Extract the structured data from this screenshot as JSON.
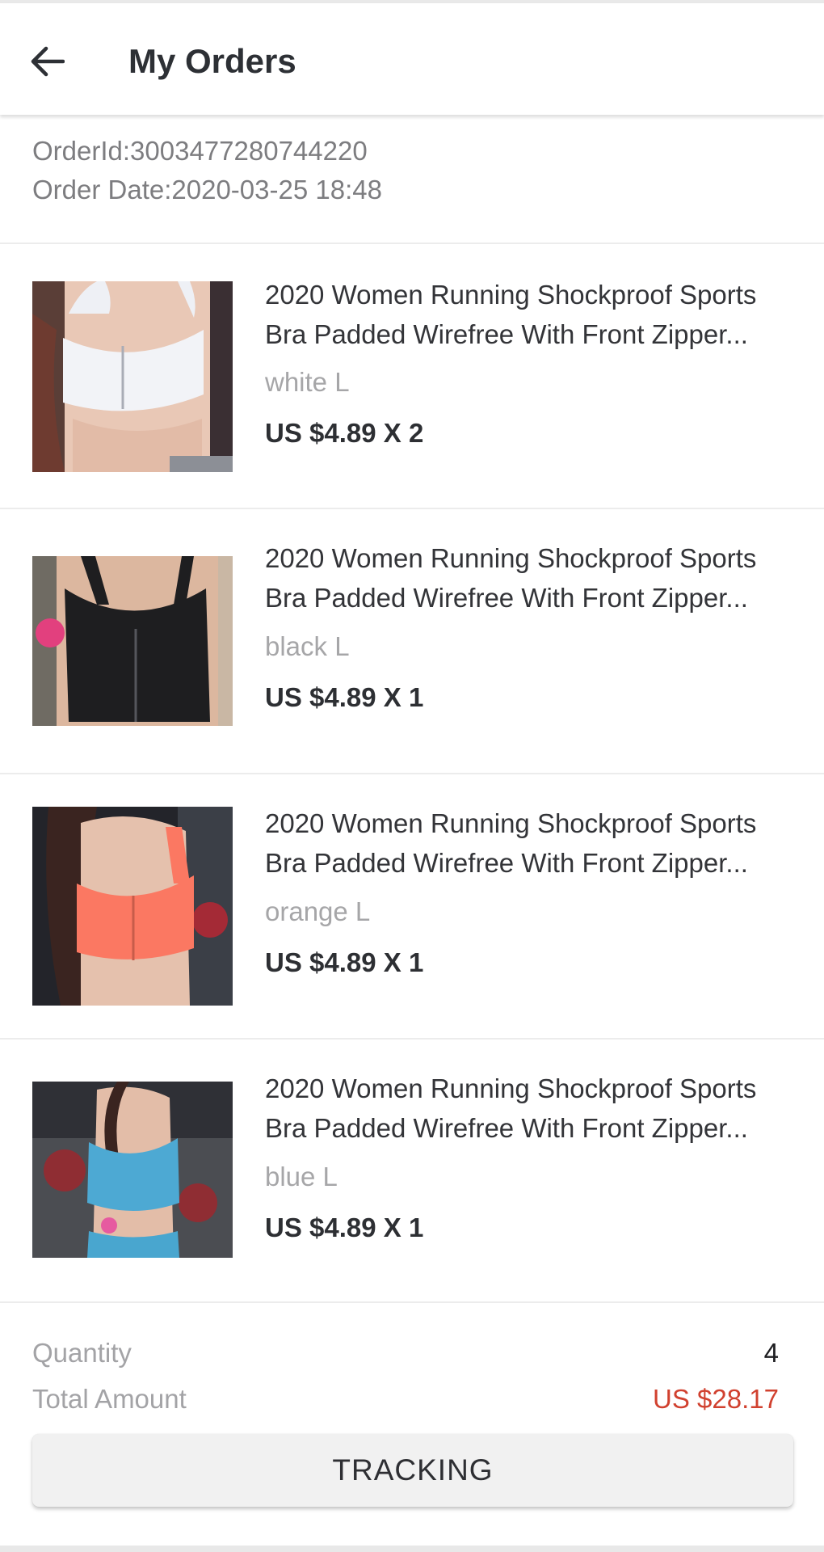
{
  "header": {
    "title": "My Orders",
    "back_icon": "arrow-left-icon"
  },
  "order": {
    "id_line": "OrderId:3003477280744220",
    "date_line": "Order Date:2020-03-25 18:48"
  },
  "items": [
    {
      "title": "2020 Women Running Shockproof Sports Bra Padded Wirefree With Front Zipper...",
      "variant": "white L",
      "price_line": "US $4.89 X 2",
      "color": "#f2f3f7"
    },
    {
      "title": "2020 Women Running Shockproof Sports Bra Padded Wirefree With Front Zipper...",
      "variant": "black L",
      "price_line": "US $4.89 X 1",
      "color": "#1e1e20"
    },
    {
      "title": "2020 Women Running Shockproof Sports Bra Padded Wirefree With Front Zipper...",
      "variant": "orange L",
      "price_line": "US $4.89 X 1",
      "color": "#fb7862"
    },
    {
      "title": "2020 Women Running Shockproof Sports Bra Padded Wirefree With Front Zipper...",
      "variant": "blue L",
      "price_line": "US $4.89 X 1",
      "color": "#4da9d3"
    }
  ],
  "summary": {
    "quantity_label": "Quantity",
    "quantity_value": "4",
    "total_label": "Total Amount",
    "total_value": "US $28.17"
  },
  "actions": {
    "tracking_label": "TRACKING"
  },
  "colors": {
    "total_red": "#d1412f",
    "divider": "#ececec"
  }
}
